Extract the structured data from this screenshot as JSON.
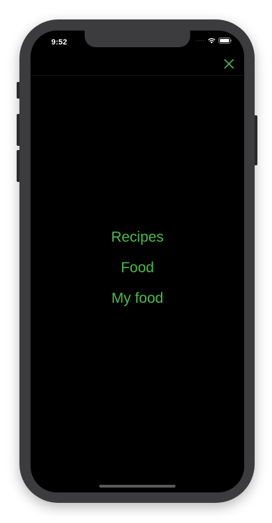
{
  "status_bar": {
    "time": "9:52",
    "signal_icon": "cellular-dots-icon",
    "wifi_icon": "wifi-icon",
    "battery_icon": "battery-icon"
  },
  "nav": {
    "close_icon": "close-icon"
  },
  "menu": {
    "items": [
      {
        "label": "Recipes"
      },
      {
        "label": "Food"
      },
      {
        "label": "My food"
      }
    ]
  },
  "colors": {
    "accent": "#4cbb4a",
    "background": "#000000",
    "status_text": "#ffffff"
  }
}
